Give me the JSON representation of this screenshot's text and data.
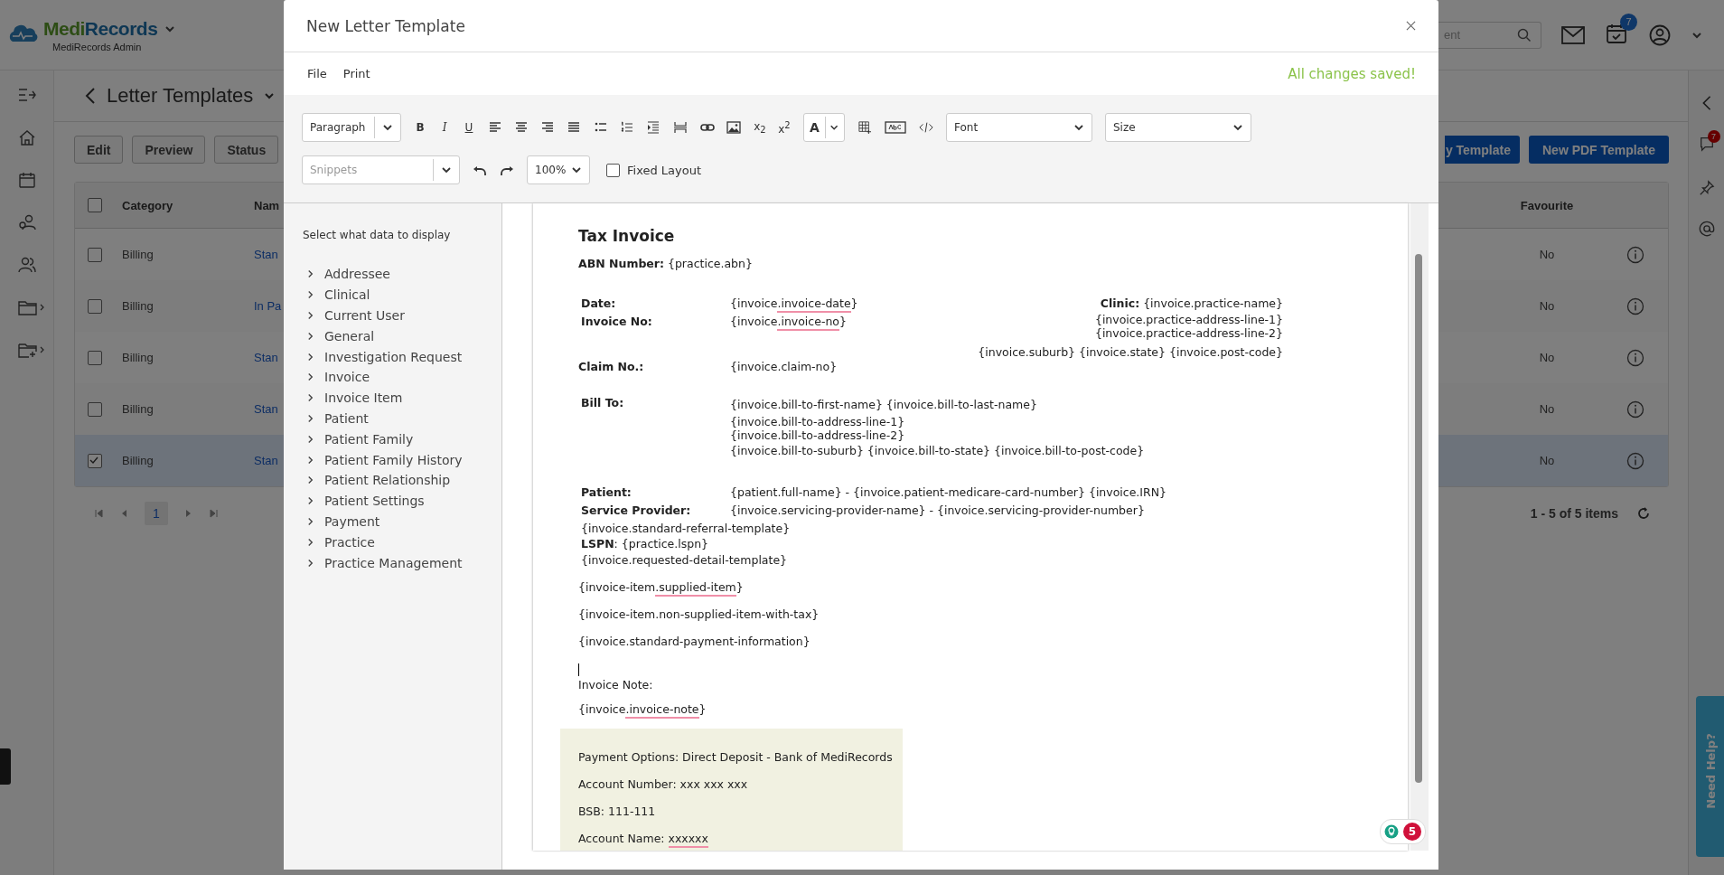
{
  "app": {
    "brand_first": "Medi",
    "brand_second": "Records",
    "subtitle": "MediRecords Admin",
    "search_placeholder": "ent",
    "calendar_badge": "7"
  },
  "page": {
    "title": "Letter Templates",
    "buttons": [
      "Edit",
      "Preview",
      "Status"
    ],
    "right_buttons": [
      "y Template",
      "New PDF Template"
    ]
  },
  "table": {
    "select_all": {
      "checked": false
    },
    "columns": [
      "Category",
      "Nam",
      "Favourite"
    ],
    "rows": [
      {
        "checked": false,
        "category": "Billing",
        "name": "Stan",
        "favourite": "No"
      },
      {
        "checked": false,
        "category": "Billing",
        "name": "In Pa",
        "favourite": "No"
      },
      {
        "checked": false,
        "category": "Billing",
        "name": "Stan",
        "favourite": "No"
      },
      {
        "checked": false,
        "category": "Billing",
        "name": "Stan",
        "favourite": "No"
      },
      {
        "checked": true,
        "category": "Billing",
        "name": "Stan",
        "favourite": "No"
      }
    ]
  },
  "pagination": {
    "page": "1",
    "summary": "1 - 5 of 5 items"
  },
  "right_rail": {
    "chat_badge": "7"
  },
  "help_tab": "Need Help?",
  "modal": {
    "title": "New Letter Template",
    "menu": [
      "File",
      "Print"
    ],
    "save_status": "All changes saved!",
    "toolbar": {
      "block_format": "Paragraph",
      "bold": "B",
      "italic": "I",
      "underline": "U",
      "subscript": "x$_{2}$",
      "superscript": "x$^{2}$",
      "font_color": "A",
      "font": "Font",
      "size": "Size",
      "snippets": "Snippets",
      "zoom": "100%",
      "fixed_layout": {
        "label": "Fixed Layout",
        "checked": false
      }
    },
    "data_panel": {
      "heading": "Select what data to display",
      "items": [
        {
          "label": "Addressee",
          "expanded": false
        },
        {
          "label": "Clinical",
          "expanded": false
        },
        {
          "label": "Current User",
          "expanded": false
        },
        {
          "label": "General",
          "expanded": false
        },
        {
          "label": "Investigation Request",
          "expanded": false
        },
        {
          "label": "Invoice",
          "expanded": false
        },
        {
          "label": "Invoice Item",
          "expanded": false
        },
        {
          "label": "Patient",
          "expanded": false
        },
        {
          "label": "Patient Family",
          "expanded": false
        },
        {
          "label": "Patient Family History",
          "expanded": false
        },
        {
          "label": "Patient Relationship",
          "expanded": false
        },
        {
          "label": "Patient Settings",
          "expanded": false
        },
        {
          "label": "Payment",
          "expanded": false
        },
        {
          "label": "Practice",
          "expanded": false
        },
        {
          "label": "Practice Management",
          "expanded": false
        }
      ]
    },
    "document": {
      "title": "Tax Invoice",
      "abn": {
        "label": "ABN Number:",
        "value": "{practice.abn}"
      },
      "date": {
        "label": "Date:",
        "value": [
          {
            "text": "{invoice",
            "misspelled": false
          },
          {
            "text": ".invoice-date",
            "misspelled": true
          },
          {
            "text": "}",
            "misspelled": false
          }
        ]
      },
      "invoice_no": {
        "label": "Invoice No:",
        "value": [
          {
            "text": "{invoice",
            "misspelled": false
          },
          {
            "text": ".invoice-no",
            "misspelled": true
          },
          {
            "text": "}",
            "misspelled": false
          }
        ]
      },
      "clinic": {
        "label": "Clinic:",
        "value": "{invoice.practice-name}"
      },
      "practice_address": [
        "{invoice.practice-address-line-1}",
        "{invoice.practice-address-line-2}",
        "{invoice.suburb} {invoice.state} {invoice.post-code}"
      ],
      "claim_no": {
        "label": "Claim No.:",
        "value": "{invoice.claim-no}"
      },
      "bill_to": {
        "label": "Bill To:",
        "lines": [
          "{invoice.bill-to-first-name} {invoice.bill-to-last-name}",
          "{invoice.bill-to-address-line-1}",
          "{invoice.bill-to-address-line-2}",
          "{invoice.bill-to-suburb} {invoice.bill-to-state} {invoice.bill-to-post-code}"
        ]
      },
      "patient": {
        "label": "Patient:",
        "value": "{patient.full-name} - {invoice.patient-medicare-card-number} {invoice.IRN}"
      },
      "service_provider": {
        "label": "Service Provider:",
        "value": "{invoice.servicing-provider-name} - {invoice.servicing-provider-number}"
      },
      "referral": "{invoice.standard-referral-template}",
      "lspn": "**LSPN**: {practice.lspn}",
      "requested": "{invoice.requested-detail-template}",
      "items": [
        [
          {
            "text": "{invoice-item",
            "misspelled": false
          },
          {
            "text": ".supplied-item",
            "misspelled": true
          },
          {
            "text": "}",
            "misspelled": false
          }
        ],
        "{invoice-item.non-supplied-item-with-tax}",
        "{invoice.standard-payment-information}"
      ],
      "note_label": "Invoice Note:",
      "note": [
        {
          "text": "{invoice",
          "misspelled": false
        },
        {
          "text": ".invoice-note",
          "misspelled": true
        },
        {
          "text": "}",
          "misspelled": false
        }
      ],
      "payment_box": [
        "Payment Options: Direct Deposit - Bank of MediRecords",
        "Account Number: xxx xxx xxx",
        "BSB: 111-111",
        [
          {
            "text": "Account Name: ",
            "misspelled": false
          },
          {
            "text": "xxxxxx",
            "misspelled": true
          }
        ]
      ]
    },
    "issue_count": "5"
  }
}
